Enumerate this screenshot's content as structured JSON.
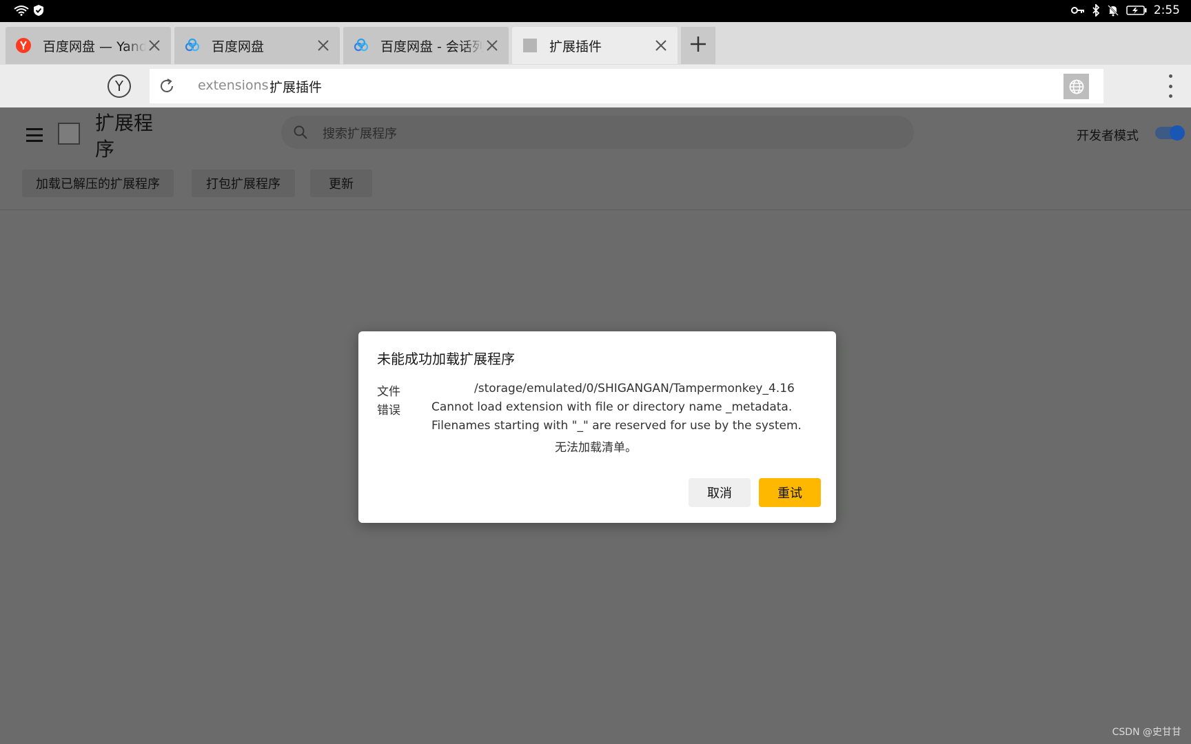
{
  "status_bar": {
    "time": "2:55",
    "left_icons": [
      "wifi-icon",
      "shield-check-icon"
    ],
    "right_icons": [
      "vpn-key-icon",
      "bluetooth-icon",
      "bell-off-icon",
      "battery-charging-icon"
    ]
  },
  "tabs": [
    {
      "title": "百度网盘 — Yand",
      "favicon": "yandex-logo",
      "favicon_color": "#ff3b1f",
      "active": false
    },
    {
      "title": "百度网盘",
      "favicon": "baidu-netdisk-logo",
      "active": false
    },
    {
      "title": "百度网盘 - 会话列",
      "favicon": "baidu-netdisk-logo",
      "active": false
    },
    {
      "title": "扩展插件",
      "favicon": "generic-page-icon",
      "active": true
    }
  ],
  "omnibox": {
    "home_glyph": "Y",
    "scheme": "extensions",
    "page_name": "扩展插件"
  },
  "page": {
    "title": "扩展程序",
    "search_placeholder": "搜索扩展程序",
    "dev_mode_label": "开发者模式",
    "dev_mode_on": true,
    "buttons": {
      "load_unpacked": "加载已解压的扩展程序",
      "pack": "打包扩展程序",
      "update": "更新"
    }
  },
  "dialog": {
    "title": "未能成功加载扩展程序",
    "file_label": "文件",
    "file_path": "/storage/emulated/0/SHIGANGAN/Tampermonkey_4.16",
    "error_label": "错误",
    "error_line1": "Cannot load extension with file or directory name _metadata.",
    "error_line2": "Filenames starting with \"_\" are reserved for use by the system.",
    "error_line3": "无法加载清单。",
    "cancel_label": "取消",
    "retry_label": "重试",
    "retry_color": "#ffb800"
  },
  "watermark": "CSDN @史甘甘"
}
